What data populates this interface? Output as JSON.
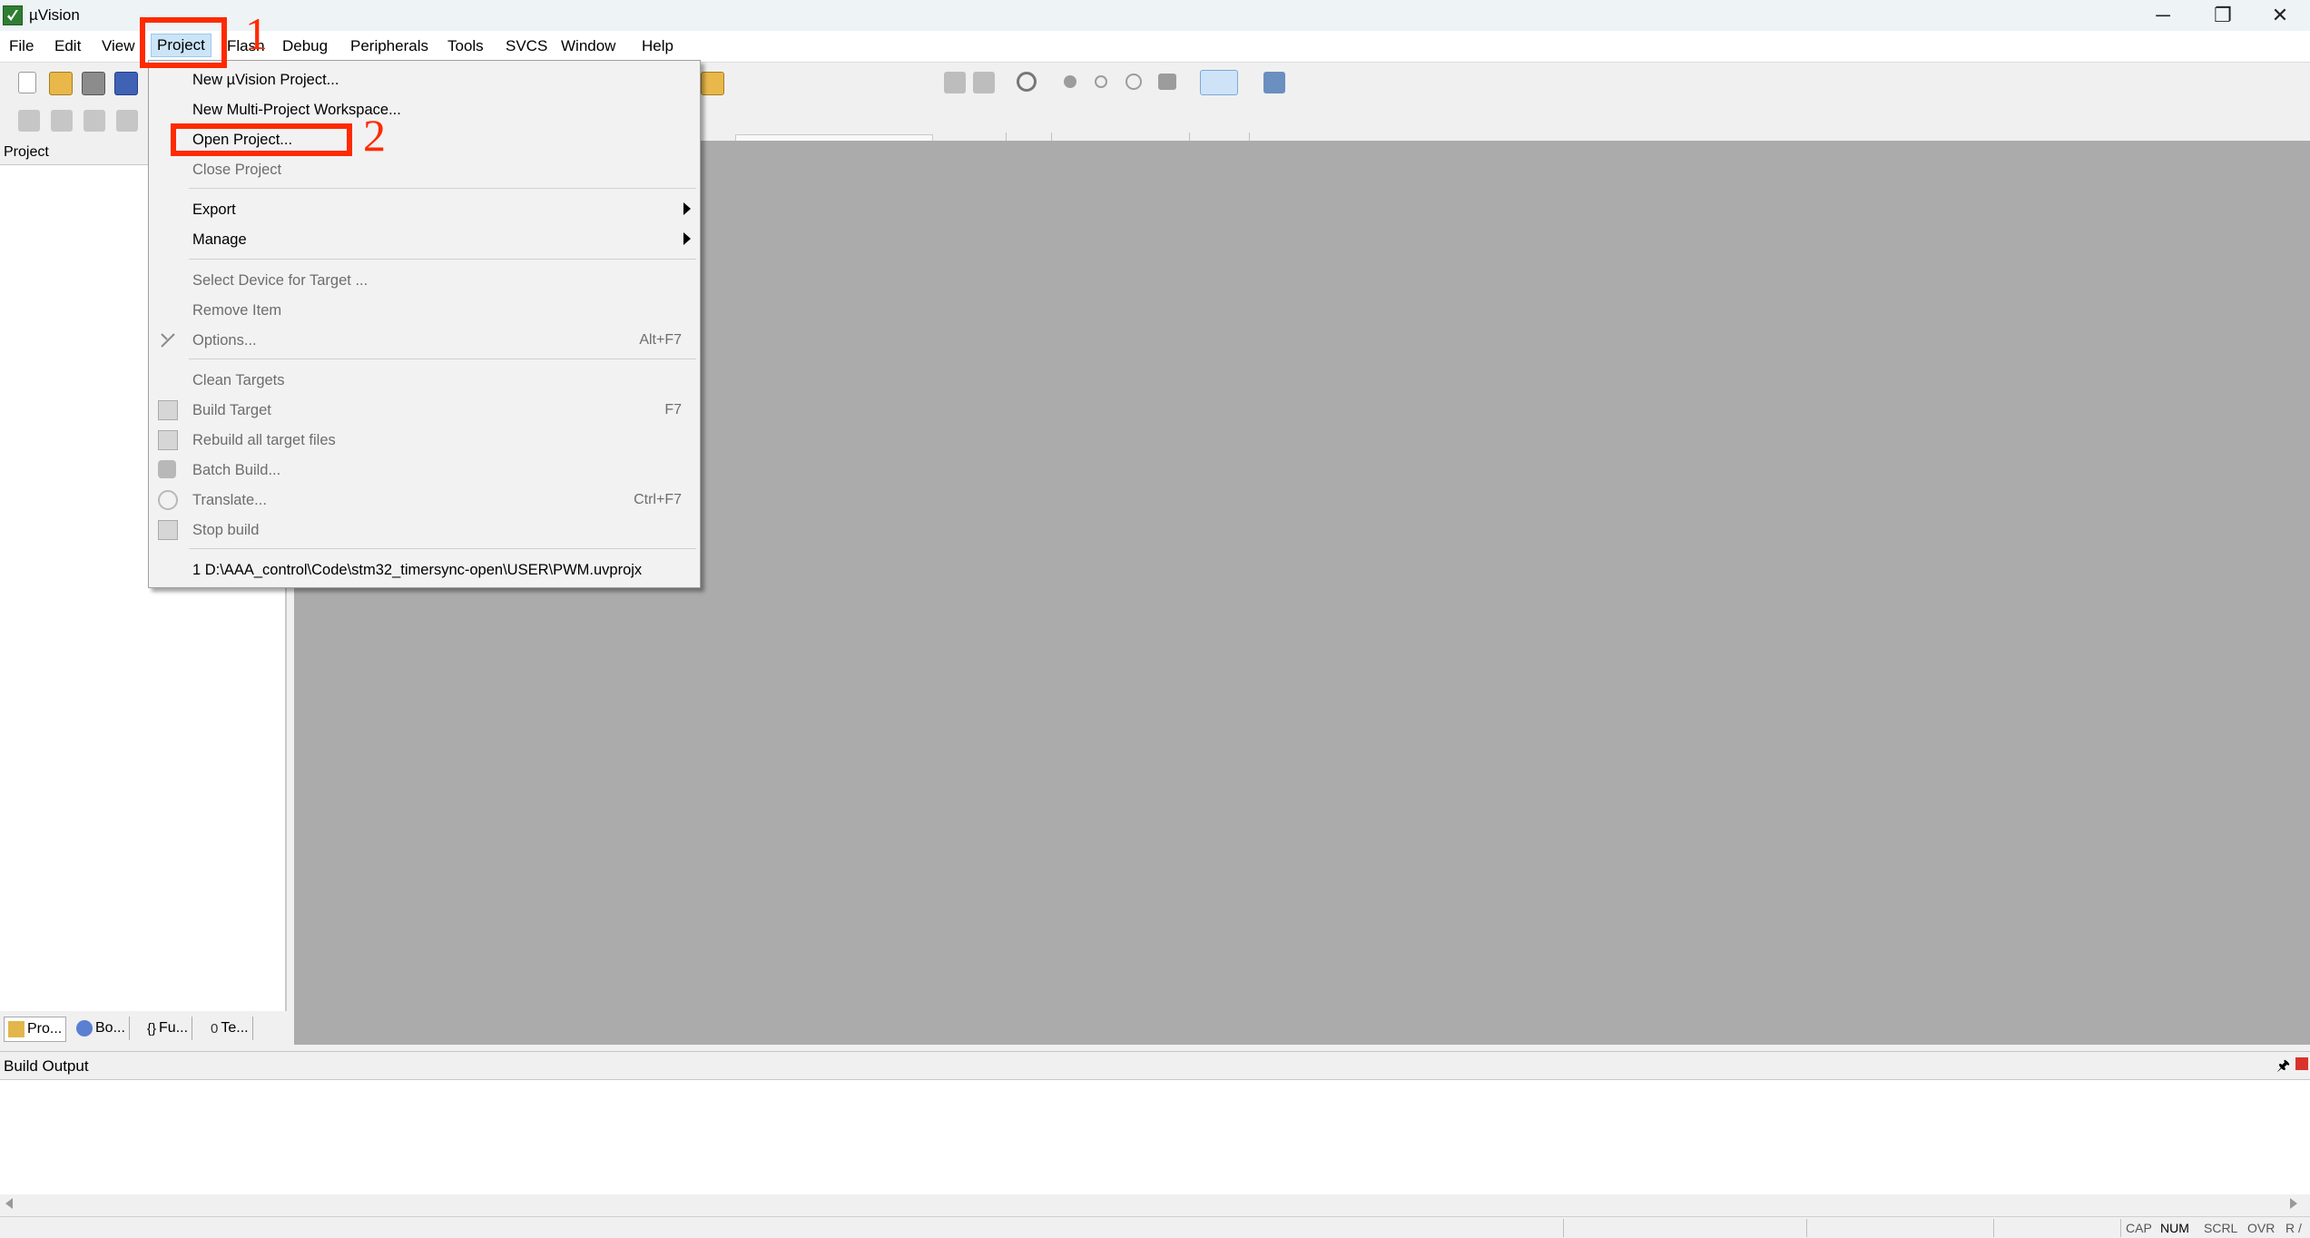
{
  "window": {
    "title": "µVision",
    "controls": [
      "─",
      "❐",
      "✕"
    ]
  },
  "menubar": {
    "items": [
      "File",
      "Edit",
      "View",
      "Project",
      "Flash",
      "Debug",
      "Peripherals",
      "Tools",
      "SVCS",
      "Window",
      "Help"
    ]
  },
  "project_panel": {
    "title": "Project",
    "tabs": [
      "Pro...",
      "Bo...",
      "Fu...",
      "Te..."
    ],
    "tab_icons": [
      "project-tab-icon",
      "books-tab-icon",
      "functions-tab-icon",
      "templates-tab-icon"
    ]
  },
  "build_output": {
    "title": "Build Output",
    "pin": "🖈"
  },
  "statusbar": {
    "indicators": [
      "CAP",
      "NUM",
      "SCRL",
      "OVR",
      "R /"
    ]
  },
  "project_menu": {
    "new_project": "New µVision Project...",
    "new_workspace": "New Multi-Project Workspace...",
    "open_project": "Open Project...",
    "close_project": "Close Project",
    "export": "Export",
    "manage": "Manage",
    "select_device": "Select Device for Target ...",
    "remove_item": "Remove Item",
    "options": "Options...",
    "options_shortcut": "Alt+F7",
    "clean_targets": "Clean Targets",
    "build_target": "Build Target",
    "build_target_shortcut": "F7",
    "rebuild_all": "Rebuild all target files",
    "batch_build": "Batch Build...",
    "translate": "Translate...",
    "translate_shortcut": "Ctrl+F7",
    "stop_build": "Stop build",
    "recent_project": "1 D:\\AAA_control\\Code\\stm32_timersync-open\\USER\\PWM.uvprojx"
  },
  "annotations": {
    "step1": "1",
    "step2": "2",
    "color": "#ff2a00"
  }
}
